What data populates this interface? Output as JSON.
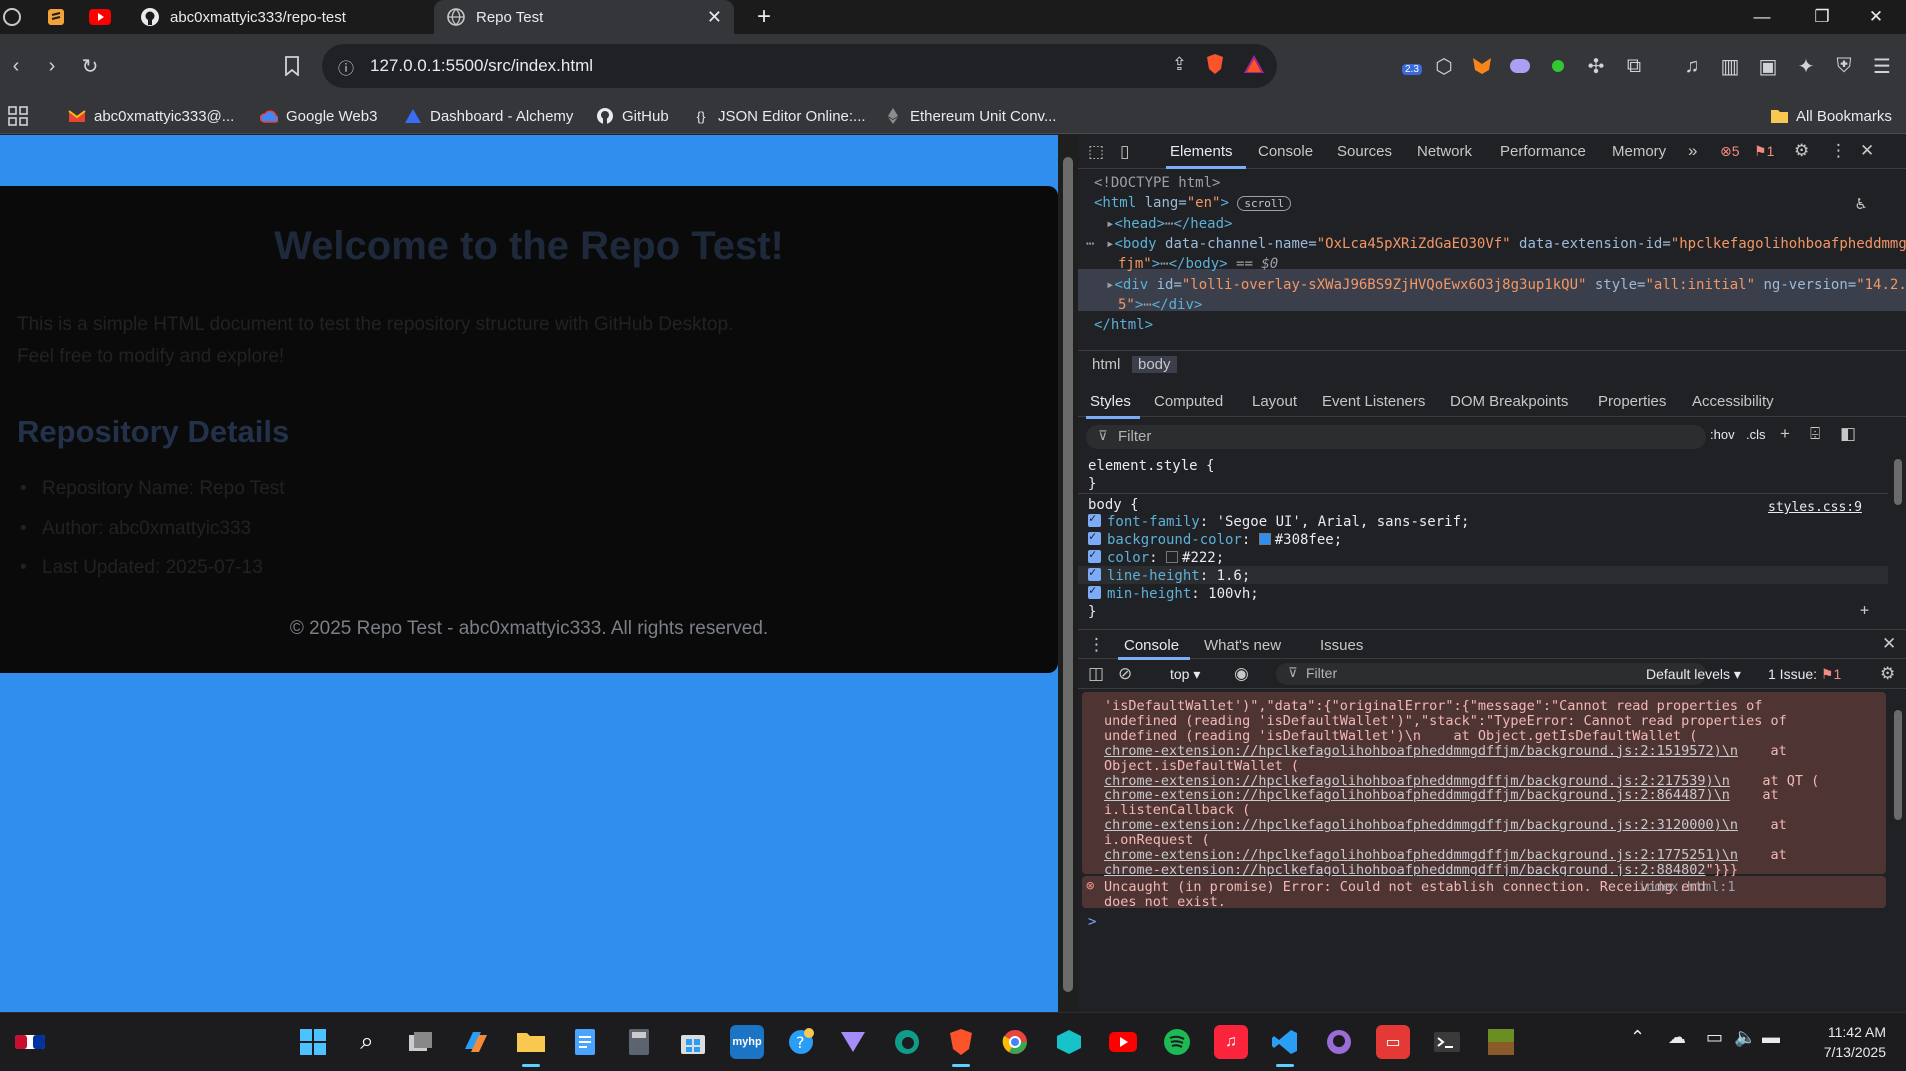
{
  "browser": {
    "tabs": [
      {
        "label": "abc0xmattyic333/repo-test",
        "icon": "github-icon"
      },
      {
        "label": "Repo Test",
        "icon": "globe-icon",
        "active": true
      }
    ],
    "url": "127.0.0.1:5500/src/index.html",
    "extension_badge": "2.3",
    "bookmarks": [
      {
        "label": "abc0xmattyic333@...",
        "icon": "gmail-icon"
      },
      {
        "label": "Google Web3",
        "icon": "google-cloud-icon"
      },
      {
        "label": "Dashboard - Alchemy",
        "icon": "alchemy-icon"
      },
      {
        "label": "GitHub",
        "icon": "github-icon"
      },
      {
        "label": "JSON Editor Online:...",
        "icon": "braces-icon"
      },
      {
        "label": "Ethereum Unit Conv...",
        "icon": "ethereum-icon"
      }
    ],
    "all_bookmarks": "All Bookmarks"
  },
  "page": {
    "h1": "Welcome to the Repo Test!",
    "p1": "This is a simple HTML document to test the repository structure with GitHub Desktop.",
    "p2": "Feel free to modify and explore!",
    "h2": "Repository Details",
    "list": [
      "Repository Name: Repo Test",
      "Author: abc0xmattyic333",
      "Last Updated: 2025-07-13"
    ],
    "footer": "© 2025 Repo Test - abc0xmattyic333. All rights reserved.",
    "colors": {
      "background": "#308fee",
      "container": "#0a0a0a",
      "text": "#222"
    }
  },
  "devtools": {
    "tabs": [
      "Elements",
      "Console",
      "Sources",
      "Network",
      "Performance",
      "Memory"
    ],
    "errors_count": "5",
    "issues_count": "1",
    "dom": {
      "doctype": "<!DOCTYPE html>",
      "html_open_tag": "<html",
      "html_lang_attr": " lang=",
      "html_lang_val": "\"en\"",
      "html_close_bracket": ">",
      "scroll_badge": "scroll",
      "head": "<head>",
      "head_close": "</head>",
      "body_open": "<body",
      "body_attr1": " data-channel-name=",
      "body_val1": "\"OxLca45pXRiZdGaEO30Vf\"",
      "body_attr2": " data-extension-id=",
      "body_val2a": "\"hpclkefagolihohboafpheddmmgdf",
      "body_val2b": "fjm\"",
      "body_gt": ">",
      "body_close": "</body>",
      "body_eq": "== $0",
      "div_open": "<div",
      "div_attr1": " id=",
      "div_val1": "\"lolli-overlay-sXWaJ96BS9ZjHVQoEwx6O3j8g3up1kQU\"",
      "div_attr2": " style=",
      "div_val2": "\"all:initial\"",
      "div_attr3": " ng-version=",
      "div_val3a": "\"14.2.",
      "div_val3b": "5\"",
      "div_gt": ">",
      "div_close": "</div>",
      "html_close": "</html>"
    },
    "breadcrumbs": [
      "html",
      "body"
    ],
    "styles_tabs": [
      "Styles",
      "Computed",
      "Layout",
      "Event Listeners",
      "DOM Breakpoints",
      "Properties",
      "Accessibility"
    ],
    "filter_placeholder": "Filter",
    "hov": ":hov",
    "cls": ".cls",
    "element_style": "element.style {",
    "brace_close": "}",
    "rule_selector": "body {",
    "rule_source": "styles.css:9",
    "declarations": [
      {
        "prop": "font-family",
        "value": "'Segoe UI', Arial, sans-serif;"
      },
      {
        "prop": "background-color",
        "value": "#308fee;",
        "swatch": "#308fee"
      },
      {
        "prop": "color",
        "value": "#222;",
        "swatch": "#222222"
      },
      {
        "prop": "line-height",
        "value": "1.6;"
      },
      {
        "prop": "min-height",
        "value": "100vh;"
      }
    ],
    "drawer_tabs": [
      "Console",
      "What's new",
      "Issues"
    ],
    "console_context": "top",
    "console_filter": "Filter",
    "default_levels": "Default levels",
    "issues_label": "1 Issue:",
    "issues_count_drawer": "1",
    "console_lines": [
      {
        "text": "'isDefaultWallet')\",\"data\":{\"originalError\":{\"message\":\"Cannot read properties of"
      },
      {
        "text": "undefined (reading 'isDefaultWallet')\",\"stack\":\"TypeError: Cannot read properties of"
      },
      {
        "text": "undefined (reading 'isDefaultWallet')\\n    at Object.getIsDefaultWallet ("
      },
      {
        "link": "chrome-extension://hpclkefagolihohboafpheddmmgdffjm/background.js:2:1519572)\\n",
        "tail": "    at"
      },
      {
        "text": "Object.isDefaultWallet ("
      },
      {
        "link": "chrome-extension://hpclkefagolihohboafpheddmmgdffjm/background.js:2:217539)\\n",
        "tail": "    at QT ("
      },
      {
        "link": "chrome-extension://hpclkefagolihohboafpheddmmgdffjm/background.js:2:864487)\\n",
        "tail": "    at"
      },
      {
        "text": "i.listenCallback ("
      },
      {
        "link": "chrome-extension://hpclkefagolihohboafpheddmmgdffjm/background.js:2:3120000)\\n",
        "tail": "    at"
      },
      {
        "text": "i.onRequest ("
      },
      {
        "link": "chrome-extension://hpclkefagolihohboafpheddmmgdffjm/background.js:2:1775251)\\n",
        "tail": "    at"
      },
      {
        "link": "chrome-extension://hpclkefagolihohboafpheddmmgdffjm/background.js:2:884802",
        "tail": "\"}}}"
      }
    ],
    "uncaught_line1": "Uncaught (in promise) Error: Could not establish connection. Receiving end",
    "uncaught_line2": "does not exist.",
    "uncaught_source": "index.html:1",
    "prompt": ">"
  },
  "taskbar": {
    "time": "11:42 AM",
    "date": "7/13/2025"
  }
}
